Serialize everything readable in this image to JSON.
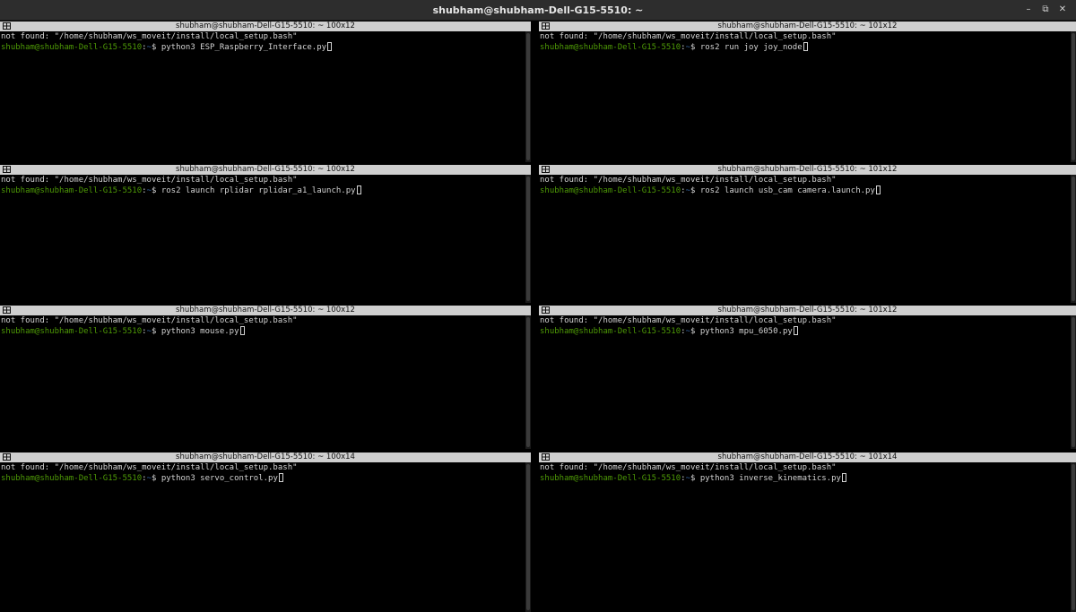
{
  "window": {
    "title": "shubham@shubham-Dell-G15-5510: ~",
    "buttons": {
      "minimize": "–",
      "maximize": "⧉",
      "close": "✕"
    }
  },
  "prompt": {
    "user_host": "shubham@shubham-Dell-G15-5510",
    "separator": ":",
    "path": "~",
    "symbol": "$ "
  },
  "panes": [
    {
      "title": "shubham@shubham-Dell-G15-5510: ~ 100x12",
      "line1": "not found: \"/home/shubham/ws_moveit/install/local_setup.bash\"",
      "command": "python3 ESP_Raspberry_Interface.py"
    },
    {
      "title": "shubham@shubham-Dell-G15-5510: ~ 101x12",
      "line1": "not found: \"/home/shubham/ws_moveit/install/local_setup.bash\"",
      "command": "ros2 run joy joy_node"
    },
    {
      "title": "shubham@shubham-Dell-G15-5510: ~ 100x12",
      "line1": "not found: \"/home/shubham/ws_moveit/install/local_setup.bash\"",
      "command": "ros2 launch rplidar rplidar_a1_launch.py"
    },
    {
      "title": "shubham@shubham-Dell-G15-5510: ~ 101x12",
      "line1": "not found: \"/home/shubham/ws_moveit/install/local_setup.bash\"",
      "command": "ros2 launch usb_cam camera.launch.py"
    },
    {
      "title": "shubham@shubham-Dell-G15-5510: ~ 100x12",
      "line1": "not found: \"/home/shubham/ws_moveit/install/local_setup.bash\"",
      "command": "python3 mouse.py"
    },
    {
      "title": "shubham@shubham-Dell-G15-5510: ~ 101x12",
      "line1": "not found: \"/home/shubham/ws_moveit/install/local_setup.bash\"",
      "command": "python3 mpu_6050.py"
    },
    {
      "title": "shubham@shubham-Dell-G15-5510: ~ 100x14",
      "line1": "not found: \"/home/shubham/ws_moveit/install/local_setup.bash\"",
      "command": "python3 servo_control.py"
    },
    {
      "title": "shubham@shubham-Dell-G15-5510: ~ 101x14",
      "line1": "not found: \"/home/shubham/ws_moveit/install/local_setup.bash\"",
      "command": "python3 inverse_kinematics.py"
    }
  ],
  "icons": {
    "pane": "terminal-split-icon"
  }
}
